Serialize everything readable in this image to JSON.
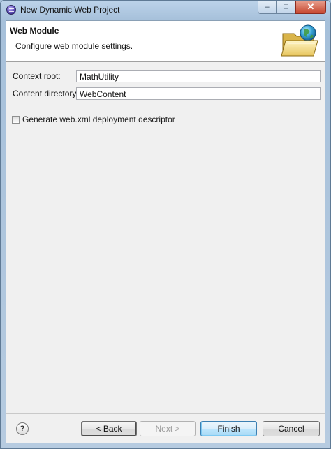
{
  "window": {
    "title": "New Dynamic Web Project",
    "minimize_glyph": "–",
    "maximize_glyph": "□",
    "close_glyph": "✕",
    "app_icon": "eclipse-icon"
  },
  "banner": {
    "title": "Web Module",
    "description": "Configure web module settings.",
    "icon": "folder-globe-icon"
  },
  "form": {
    "context_root_label": "Context root:",
    "context_root_value": "MathUtility",
    "content_directory_label": "Content directory:",
    "content_directory_value": "WebContent",
    "generate_descriptor_label": "Generate web.xml deployment descriptor",
    "generate_descriptor_checked": false
  },
  "footer": {
    "help_glyph": "?",
    "back_label": "< Back",
    "next_label": "Next >",
    "finish_label": "Finish",
    "cancel_label": "Cancel"
  },
  "colors": {
    "accent": "#3c7fb1",
    "window_frame": "#a9c3dc",
    "close_button": "#c6472f"
  }
}
